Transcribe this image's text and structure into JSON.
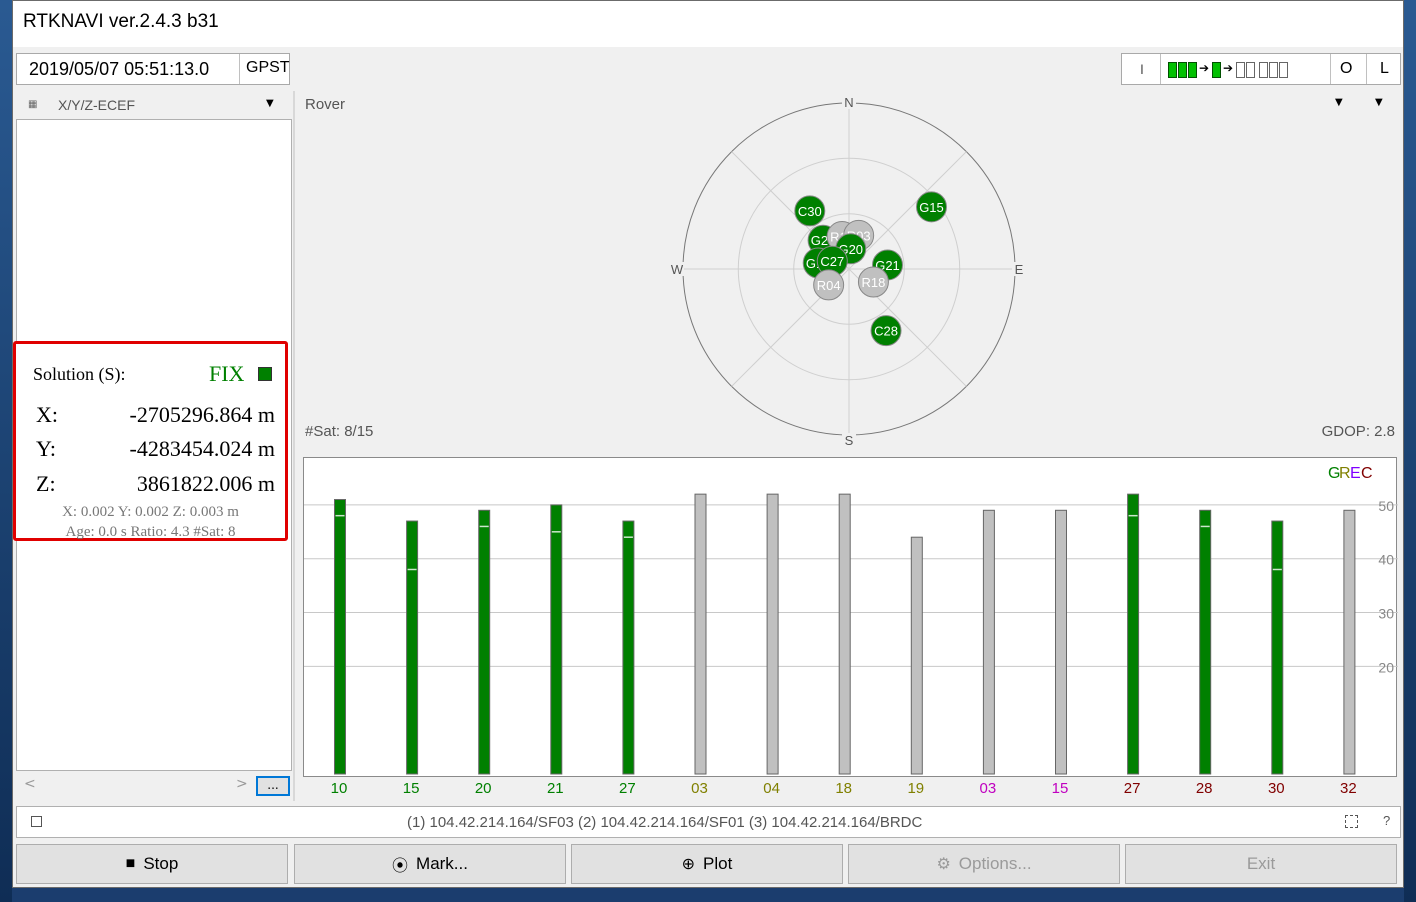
{
  "window": {
    "title": "RTKNAVI ver.2.4.3 b31",
    "time": "2019/05/07 05:51:13.0",
    "time_system": "GPST"
  },
  "toolbar_right": {
    "input_label": "I",
    "output_label": "O",
    "log_label": "L"
  },
  "left_panel": {
    "coord_select": "X/Y/Z-ECEF",
    "solution_label": "Solution (S):",
    "solution_status": "FIX",
    "x_label": "X:",
    "x_value": "-2705296.864 m",
    "y_label": "Y:",
    "y_value": "-4283454.024 m",
    "z_label": "Z:",
    "z_value": "3861822.006 m",
    "std_line": "X: 0.002 Y: 0.002 Z: 0.003 m",
    "age_line": "Age: 0.0 s Ratio: 4.3 #Sat: 8",
    "more_button": "..."
  },
  "skyplot": {
    "title": "Rover",
    "nsat": "#Sat: 8/15",
    "gdop": "GDOP: 2.8",
    "directions": {
      "n": "N",
      "s": "S",
      "e": "E",
      "w": "W"
    },
    "satellites": [
      {
        "id": "C30",
        "az": -34,
        "el": 52,
        "used": true
      },
      {
        "id": "G15",
        "az": 53,
        "el": 34,
        "used": true
      },
      {
        "id": "G27",
        "az": -42,
        "el": 69,
        "used": true
      },
      {
        "id": "R19",
        "az": -12,
        "el": 72,
        "used": false
      },
      {
        "id": "R03",
        "az": 16,
        "el": 71,
        "used": false
      },
      {
        "id": "G20",
        "az": 5,
        "el": 79,
        "used": true
      },
      {
        "id": "G10",
        "az": -79,
        "el": 73,
        "used": true
      },
      {
        "id": "C27",
        "az": -65,
        "el": 80,
        "used": true
      },
      {
        "id": "G21",
        "az": 84,
        "el": 69,
        "used": true
      },
      {
        "id": "R04",
        "az": -128,
        "el": 76,
        "used": false
      },
      {
        "id": "R18",
        "az": 118,
        "el": 75,
        "used": false
      },
      {
        "id": "C28",
        "az": 149,
        "el": 51,
        "used": true
      }
    ]
  },
  "colors": {
    "used": "#008000",
    "unused": "#c0c0c0",
    "fix": "#008000"
  },
  "chart_data": {
    "type": "bar",
    "legend": [
      "G",
      "R",
      "E",
      "C"
    ],
    "legend_colors": [
      "#008000",
      "#808000",
      "#8000ff",
      "#800000"
    ],
    "categories": [
      "10",
      "15",
      "20",
      "21",
      "27",
      "03",
      "04",
      "18",
      "19",
      "03",
      "15",
      "27",
      "28",
      "30",
      "32"
    ],
    "category_colors": [
      "#008000",
      "#008000",
      "#008000",
      "#008000",
      "#008000",
      "#808000",
      "#808000",
      "#808000",
      "#808000",
      "#c000c0",
      "#c000c0",
      "#800000",
      "#800000",
      "#800000",
      "#800000"
    ],
    "values": [
      51,
      47,
      49,
      50,
      47,
      52,
      52,
      52,
      44,
      49,
      49,
      52,
      49,
      47,
      49
    ],
    "used": [
      true,
      true,
      true,
      true,
      true,
      false,
      false,
      false,
      false,
      false,
      false,
      true,
      true,
      true,
      false
    ],
    "markers": [
      48,
      38,
      46,
      45,
      44,
      null,
      null,
      null,
      null,
      null,
      null,
      48,
      46,
      38,
      null
    ],
    "yticks": [
      "20",
      "30",
      "40",
      "50"
    ],
    "ylim": [
      0,
      55
    ]
  },
  "status_bar": {
    "streams": "(1) 104.42.214.164/SF03 (2) 104.42.214.164/SF01 (3) 104.42.214.164/BRDC",
    "help": "?"
  },
  "buttons": {
    "stop": "Stop",
    "mark": "Mark...",
    "plot": "Plot",
    "options": "Options...",
    "exit": "Exit"
  }
}
